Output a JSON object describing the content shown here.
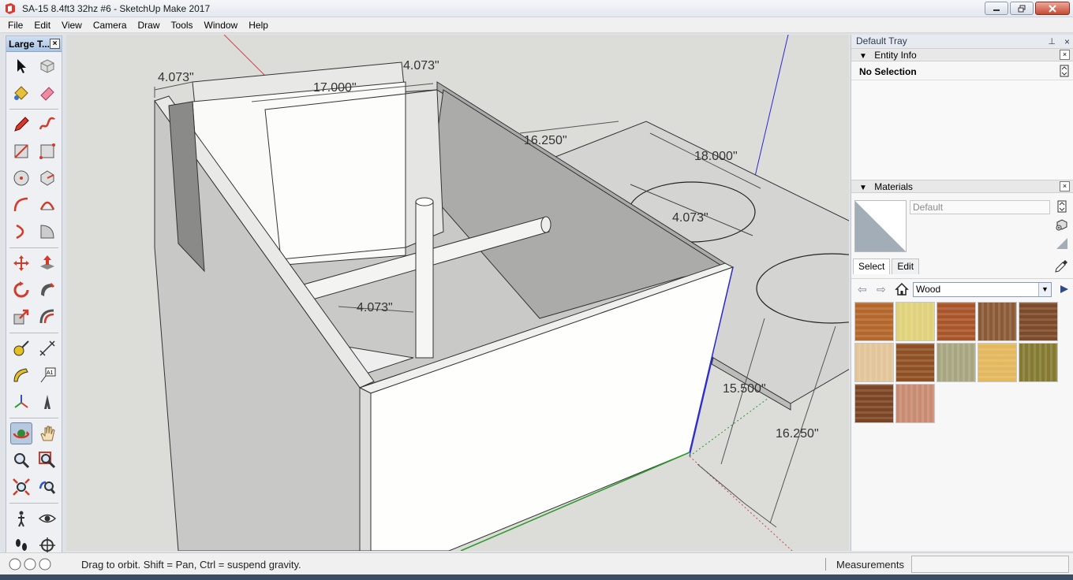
{
  "window": {
    "title": "SA-15 8.4ft3 32hz #6 - SketchUp Make 2017"
  },
  "menu": {
    "items": [
      "File",
      "Edit",
      "View",
      "Camera",
      "Draw",
      "Tools",
      "Window",
      "Help"
    ]
  },
  "toolbar": {
    "title": "Large T...",
    "tools": [
      "select",
      "component",
      "paint-bucket",
      "eraser",
      "line",
      "freehand",
      "rectangle",
      "rotated-rectangle",
      "circle",
      "polygon",
      "arc",
      "two-point-arc",
      "three-point-arc",
      "pie",
      "move",
      "push-pull",
      "rotate",
      "follow-me",
      "scale",
      "offset",
      "tape-measure",
      "dimension",
      "protractor",
      "text",
      "axes",
      "3d-text",
      "orbit",
      "pan",
      "zoom",
      "zoom-window",
      "zoom-extents",
      "previous-view",
      "position-camera",
      "look-around",
      "walk",
      "section-plane"
    ],
    "active_tool": "orbit"
  },
  "model": {
    "dimensions": [
      "4.073\"",
      "4.073\"",
      "17.000\"",
      "16.250\"",
      "18.000\"",
      "4.073\"",
      "4.073\"",
      "15.500\"",
      "16.250\""
    ]
  },
  "tray": {
    "title": "Default Tray",
    "entity_info": {
      "header": "Entity Info",
      "selection": "No Selection"
    },
    "materials": {
      "header": "Materials",
      "material_name": "Default",
      "tabs": [
        "Select",
        "Edit"
      ],
      "active_tab": "Select",
      "library": "Wood",
      "swatches": [
        "#b4672a",
        "#e0d27a",
        "#a9552a",
        "#8b5a36",
        "#7d4a2a",
        "#e2c69a",
        "#8e4f22",
        "#a8a680",
        "#e4b85c",
        "#857a32",
        "#7b4424",
        "#c98c72"
      ]
    }
  },
  "status": {
    "message": "Drag to orbit. Shift = Pan, Ctrl = suspend gravity.",
    "measurements_label": "Measurements",
    "measurements_value": ""
  }
}
